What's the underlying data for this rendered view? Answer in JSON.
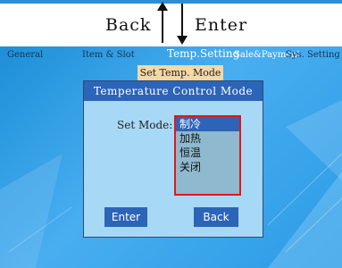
{
  "nav_hints": {
    "back_label": "Back",
    "enter_label": "Enter"
  },
  "menu": {
    "items": [
      {
        "label": "General"
      },
      {
        "label": "Item & Slot"
      },
      {
        "label": "Temp.Setting"
      },
      {
        "label": "Sale&Payment"
      },
      {
        "label": "Sys. Setting"
      }
    ],
    "active": "Temp.Setting",
    "submenu_label": "Set Temp. Mode"
  },
  "dialog": {
    "title": "Temperature Control Mode",
    "mode_label": "Set Mode:",
    "options": [
      "制冷",
      "加热",
      "恒温",
      "关闭"
    ],
    "selected_option": "制冷",
    "enter_label": "Enter",
    "back_label": "Back"
  },
  "colors": {
    "screen_bg": "#2b9be6",
    "menu_active_text": "#ffffff",
    "submenu_bg": "#f3d8a8",
    "dialog_bg": "#a7d8f5",
    "dialog_title_bg": "#2c64b8",
    "selection_border": "#e01818",
    "button_bg": "#2c64b8"
  }
}
